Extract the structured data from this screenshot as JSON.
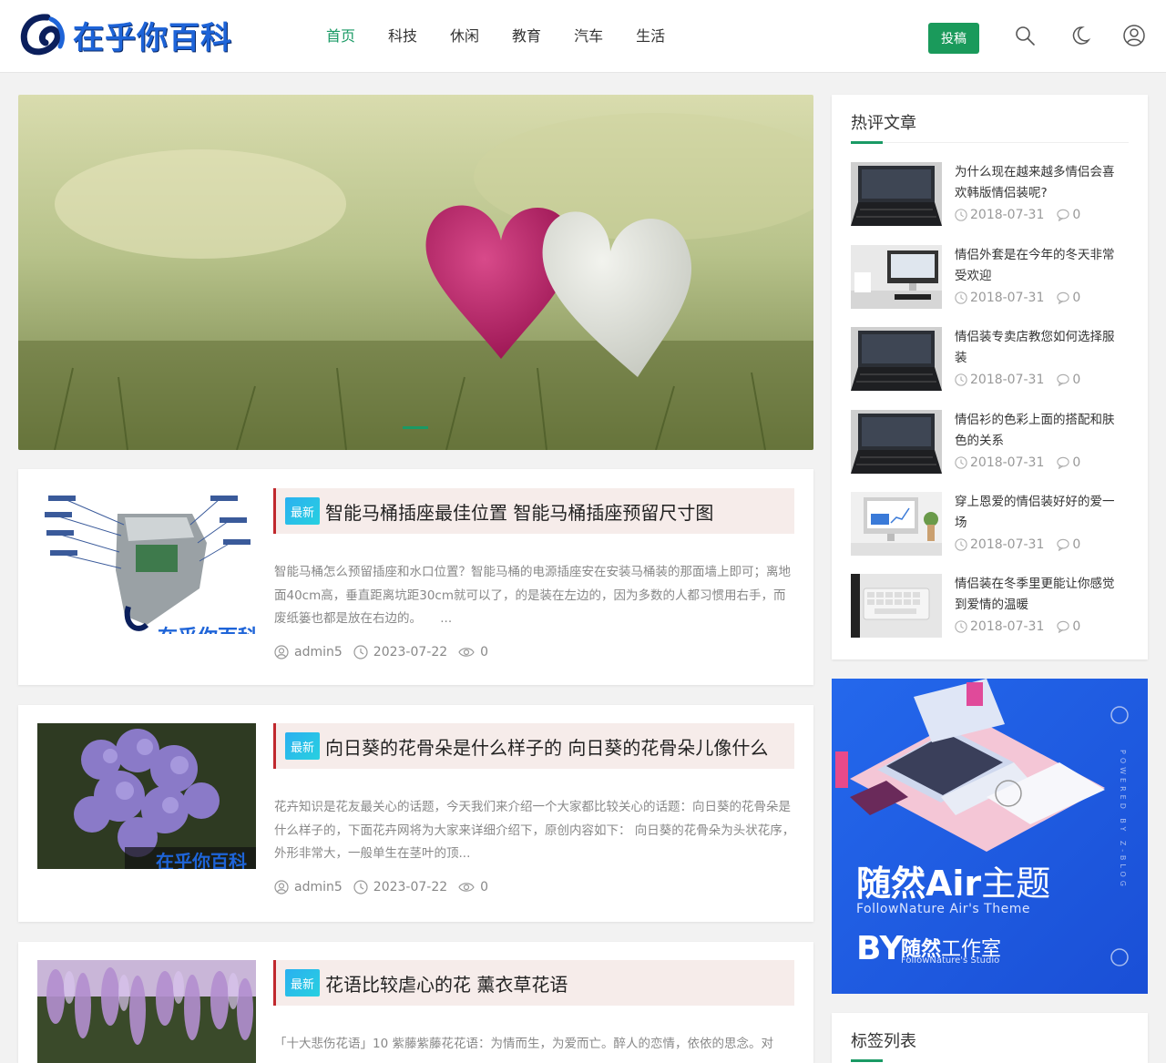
{
  "header": {
    "logo_text": "在乎你百科",
    "nav": [
      {
        "label": "首页",
        "active": true
      },
      {
        "label": "科技",
        "active": false
      },
      {
        "label": "休闲",
        "active": false
      },
      {
        "label": "教育",
        "active": false
      },
      {
        "label": "汽车",
        "active": false
      },
      {
        "label": "生活",
        "active": false
      }
    ],
    "submit_label": "投稿",
    "icons": [
      "search-icon",
      "moon-icon",
      "user-icon"
    ],
    "accent_color": "#1a9a65"
  },
  "banner": {
    "image": "two-hearts-on-grass",
    "slide_indicator": "active"
  },
  "posts": [
    {
      "badge": "最新",
      "title": "智能马桶插座最佳位置 智能马桶插座预留尺寸图",
      "excerpt": "智能马桶怎么预留插座和水口位置？智能马桶的电源插座安在安装马桶装的那面墙上即可；离地面40cm高，垂直距离坑距30cm就可以了，的是装在左边的，因为多数的人都习惯用右手，而废纸篓也都是放在右边的。　　...",
      "author": "admin5",
      "date": "2023-07-22",
      "views": "0",
      "thumb": "toilet-diagram",
      "thumb_watermark": "在乎你百科"
    },
    {
      "badge": "最新",
      "title": "向日葵的花骨朵是什么样子的 向日葵的花骨朵儿像什么",
      "excerpt": "花卉知识是花友最关心的话题，今天我们来介绍一个大家都比较关心的话题：向日葵的花骨朵是什么样子的，下面花卉网将为大家来详细介绍下，原创内容如下： 向日葵的花骨朵为头状花序，外形非常大，一般单生在茎叶的顶...",
      "author": "admin5",
      "date": "2023-07-22",
      "views": "0",
      "thumb": "purple-hydrangea",
      "thumb_watermark": "在乎你百科"
    },
    {
      "badge": "最新",
      "title": "花语比较虐心的花 薰衣草花语",
      "excerpt": "「十大悲伤花语」10 紫藤紫藤花花语：为情而生，为爱而亡。醉人的恋情，依依的思念。对",
      "thumb": "wisteria"
    }
  ],
  "sidebar": {
    "hot_title": "热评文章",
    "hot_items": [
      {
        "title": "为什么现在越来越多情侣会喜欢韩版情侣装呢?",
        "date": "2018-07-31",
        "comments": "0",
        "thumb": "laptop"
      },
      {
        "title": "情侣外套是在今年的冬天非常受欢迎",
        "date": "2018-07-31",
        "comments": "0",
        "thumb": "desk-monitor"
      },
      {
        "title": "情侣装专卖店教您如何选择服装",
        "date": "2018-07-31",
        "comments": "0",
        "thumb": "laptop"
      },
      {
        "title": "情侣衫的色彩上面的搭配和肤色的关系",
        "date": "2018-07-31",
        "comments": "0",
        "thumb": "laptop"
      },
      {
        "title": "穿上恩爱的情侣装好好的爱一场",
        "date": "2018-07-31",
        "comments": "0",
        "thumb": "imac-desk"
      },
      {
        "title": "情侣装在冬季里更能让你感觉到爱情的温暖",
        "date": "2018-07-31",
        "comments": "0",
        "thumb": "keyboard"
      }
    ],
    "ad": {
      "title_a": "随然Air",
      "title_b": "主题",
      "subtitle": "FollowNature Air's Theme",
      "by": "BY",
      "studio_a": "随然",
      "studio_b": "工作室",
      "studio_sub": "FollowNature's Studio",
      "vertical": "POWERED BY Z-BLOG",
      "bg_color": "#1e54e0"
    },
    "tags_title": "标签列表"
  }
}
